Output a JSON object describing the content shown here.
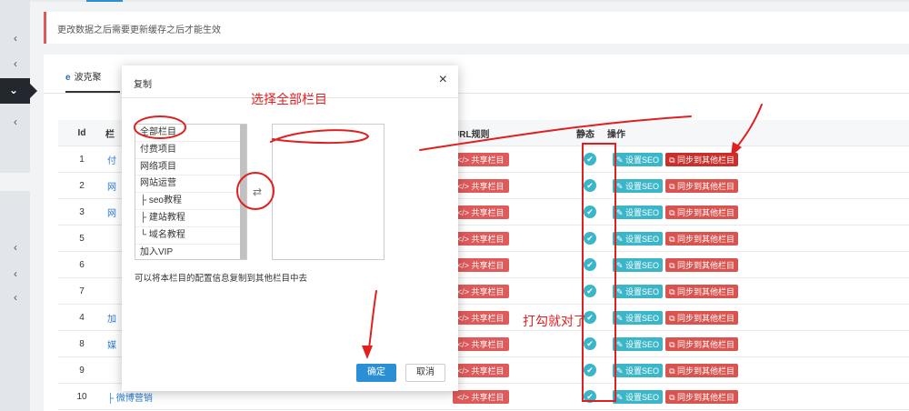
{
  "notice": "更改数据之后需要更新缓存之后才能生效",
  "tab": {
    "label": "波克聚"
  },
  "table": {
    "headers": {
      "id": "Id",
      "column": "栏",
      "url_rule": "URL规则",
      "static": "静态",
      "actions": "操作"
    },
    "rows": [
      {
        "id": "1",
        "name": "付"
      },
      {
        "id": "2",
        "name": "网"
      },
      {
        "id": "3",
        "name": "网"
      },
      {
        "id": "5",
        "name": ""
      },
      {
        "id": "6",
        "name": ""
      },
      {
        "id": "7",
        "name": ""
      },
      {
        "id": "4",
        "name": "加"
      },
      {
        "id": "8",
        "name": "媒"
      },
      {
        "id": "9",
        "name": ""
      },
      {
        "id": "10",
        "name": "├ 微博营销"
      }
    ],
    "share_label": "共享栏目",
    "seo_label": "设置SEO",
    "sync_label": "同步到其他栏目"
  },
  "modal": {
    "title": "复制",
    "source_options": [
      "全部栏目",
      "付费项目",
      "网络项目",
      "网站运营",
      "├ seo教程",
      "├ 建站教程",
      "└ 域名教程",
      "加入VIP"
    ],
    "help": "可以将本栏目的配置信息复制到其他栏目中去",
    "ok_label": "确定",
    "cancel_label": "取消"
  },
  "annotations": {
    "select_all": "选择全部栏目",
    "check_it": "打勾就对了"
  },
  "colors": {
    "primary": "#2b8fd6",
    "danger": "#e05a5a",
    "teal": "#3bb6c9",
    "annotation": "#e02020"
  }
}
